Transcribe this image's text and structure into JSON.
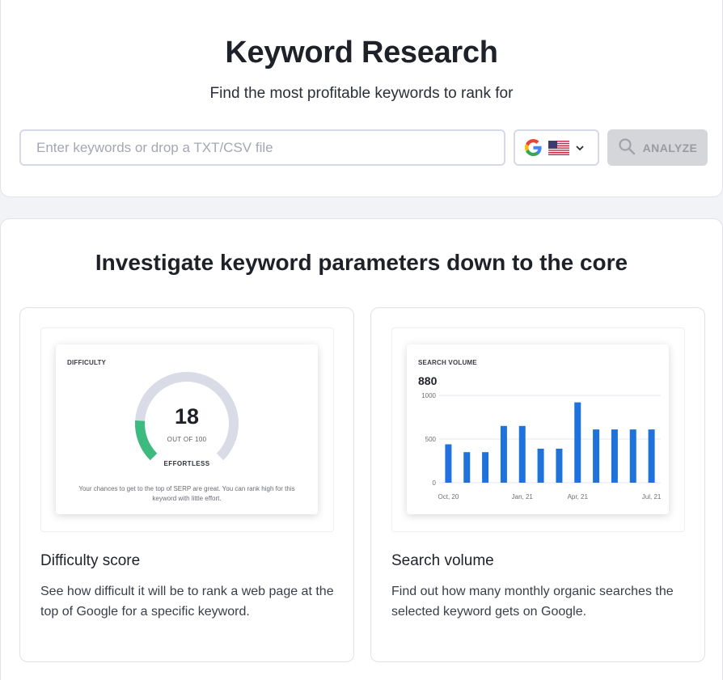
{
  "header": {
    "title": "Keyword Research",
    "subtitle": "Find the most profitable keywords to rank for"
  },
  "search": {
    "placeholder": "Enter keywords or drop a TXT/CSV file",
    "value": ""
  },
  "engine_select": {
    "engine_icon": "google-g-icon",
    "country_icon": "us-flag-icon"
  },
  "analyze_button": {
    "label": "ANALYZE",
    "icon": "search-icon"
  },
  "features": {
    "heading": "Investigate keyword parameters down to the core",
    "cards": [
      {
        "title": "Difficulty score",
        "description": "See how difficult it will be to rank a web page at the top of Google for a specific keyword.",
        "preview": {
          "label": "DIFFICULTY",
          "score": "18",
          "score_max_text": "OUT OF 100",
          "score_fraction": 0.18,
          "rating": "EFFORTLESS",
          "note": "Your chances to get to the top of SERP are great. You can rank high for this keyword with little effort."
        }
      },
      {
        "title": "Search volume",
        "description": "Find out how many monthly organic searches the selected keyword gets on Google.",
        "preview": {
          "label": "SEARCH VOLUME",
          "value": "880"
        }
      }
    ]
  },
  "colors": {
    "gauge_fill": "#3dba7e",
    "gauge_track": "#d9dbe6",
    "bar": "#1f72dc",
    "analyze_disabled": "#d5d6da"
  },
  "chart_data": {
    "type": "bar",
    "title": "SEARCH VOLUME",
    "values": [
      440,
      350,
      350,
      650,
      650,
      390,
      390,
      920,
      610,
      610,
      610,
      610
    ],
    "x_tick_labels": [
      {
        "index": 0,
        "label": "Oct, 20"
      },
      {
        "index": 4,
        "label": "Jan, 21"
      },
      {
        "index": 7,
        "label": "Apr, 21"
      },
      {
        "index": 11,
        "label": "Jul, 21"
      }
    ],
    "y_ticks": [
      0,
      500,
      1000
    ],
    "ylim": [
      0,
      1000
    ],
    "grid": true,
    "legend": "none"
  }
}
